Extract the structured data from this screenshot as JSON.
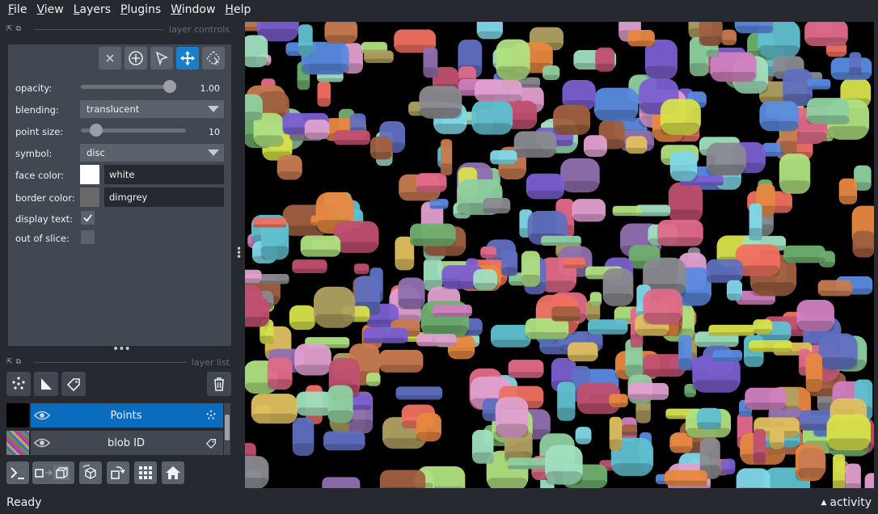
{
  "menu": [
    "File",
    "View",
    "Layers",
    "Plugins",
    "Window",
    "Help"
  ],
  "layer_controls": {
    "title": "layer controls",
    "opacity": {
      "label": "opacity:",
      "value": "1.00",
      "fraction": 1.0
    },
    "blending": {
      "label": "blending:",
      "value": "translucent"
    },
    "point_size": {
      "label": "point size:",
      "value": "10",
      "fraction": 0.1
    },
    "symbol": {
      "label": "symbol:",
      "value": "disc"
    },
    "face_color": {
      "label": "face color:",
      "value": "white",
      "swatch": "#ffffff"
    },
    "border_color": {
      "label": "border color:",
      "value": "dimgrey",
      "swatch": "#696969"
    },
    "display_text": {
      "label": "display text:",
      "checked": true
    },
    "out_of_slice": {
      "label": "out of slice:",
      "checked": false
    }
  },
  "layer_list": {
    "title": "layer list",
    "layers": [
      {
        "name": "Points",
        "selected": true,
        "type_icon": "points-icon"
      },
      {
        "name": "blob ID",
        "selected": false,
        "type_icon": "labels-icon"
      }
    ]
  },
  "status": {
    "text": "Ready",
    "activity": "activity"
  },
  "colors": {
    "background": "#262930",
    "panel": "#414851",
    "accent": "#1a7ecf",
    "button": "#5a626c"
  }
}
